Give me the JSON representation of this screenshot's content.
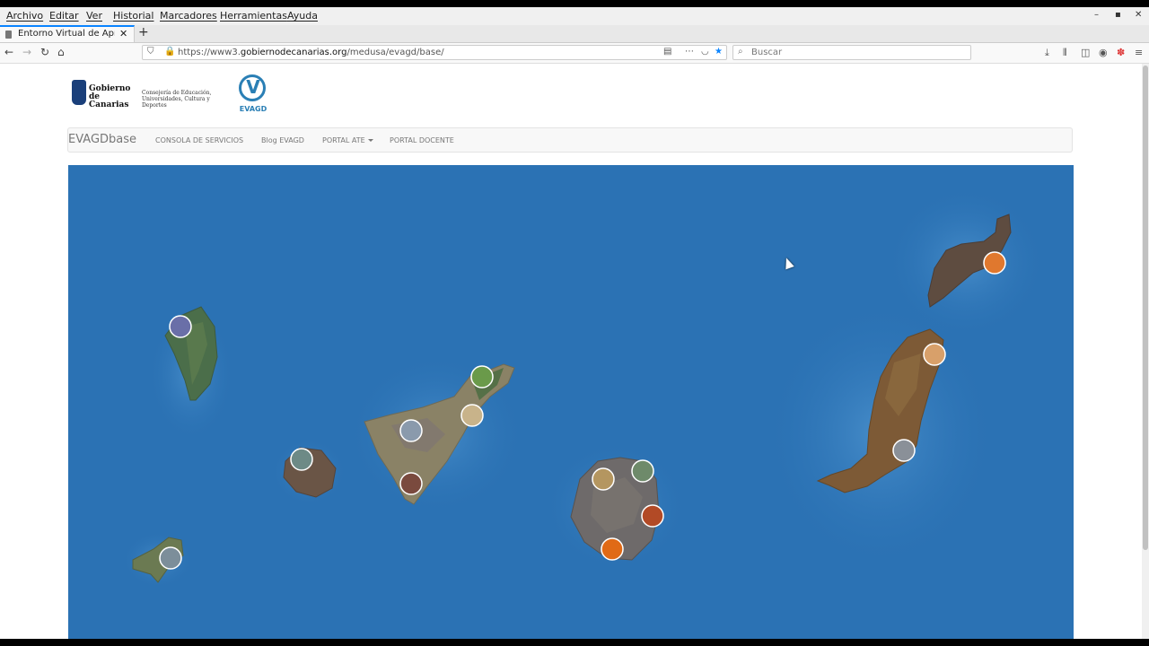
{
  "menubar": {
    "items": [
      "Archivo",
      "Editar",
      "Ver",
      "Historial",
      "Marcadores",
      "Herramientas",
      "Ayuda"
    ]
  },
  "tab": {
    "title": "Entorno Virtual de Apre",
    "close": "✕",
    "new_tab": "+"
  },
  "nav": {
    "url_prefix": "https://www3.",
    "url_domain": "gobiernodecanarias.org",
    "url_path": "/medusa/evagd/base/",
    "search_placeholder": "Buscar"
  },
  "header": {
    "gob_line1": "Gobierno",
    "gob_line2": "de Canarias",
    "consejeria_line1": "Consejería de Educación,",
    "consejeria_line2": "Universidades, Cultura y Deportes",
    "evagd_logo_text": "EVAGD"
  },
  "site_nav": {
    "brand": "EVAGDbase",
    "links": [
      "CONSOLA DE SERVICIOS",
      "Blog EVAGD",
      "PORTAL ATE",
      "PORTAL DOCENTE"
    ]
  },
  "map": {
    "background_color": "#2b72b4",
    "islands": [
      "La Palma",
      "El Hierro",
      "La Gomera",
      "Tenerife",
      "Gran Canaria",
      "Fuerteventura",
      "Lanzarote"
    ],
    "markers": [
      {
        "island": "La Palma",
        "color": "#6a6fa8"
      },
      {
        "island": "El Hierro",
        "color": "#7c8e9a"
      },
      {
        "island": "La Gomera",
        "color": "#6d8a86"
      },
      {
        "island": "Tenerife",
        "color": "#6a9a4a"
      },
      {
        "island": "Tenerife",
        "color": "#c8b38a"
      },
      {
        "island": "Tenerife",
        "color": "#8a9aac"
      },
      {
        "island": "Tenerife",
        "color": "#7a4a3e"
      },
      {
        "island": "Gran Canaria",
        "color": "#b49660"
      },
      {
        "island": "Gran Canaria",
        "color": "#6e8a6a"
      },
      {
        "island": "Gran Canaria",
        "color": "#b24a26"
      },
      {
        "island": "Gran Canaria",
        "color": "#e06a16"
      },
      {
        "island": "Fuerteventura",
        "color": "#d8a06a"
      },
      {
        "island": "Fuerteventura",
        "color": "#8a9098"
      },
      {
        "island": "Lanzarote",
        "color": "#e0782e"
      }
    ]
  }
}
